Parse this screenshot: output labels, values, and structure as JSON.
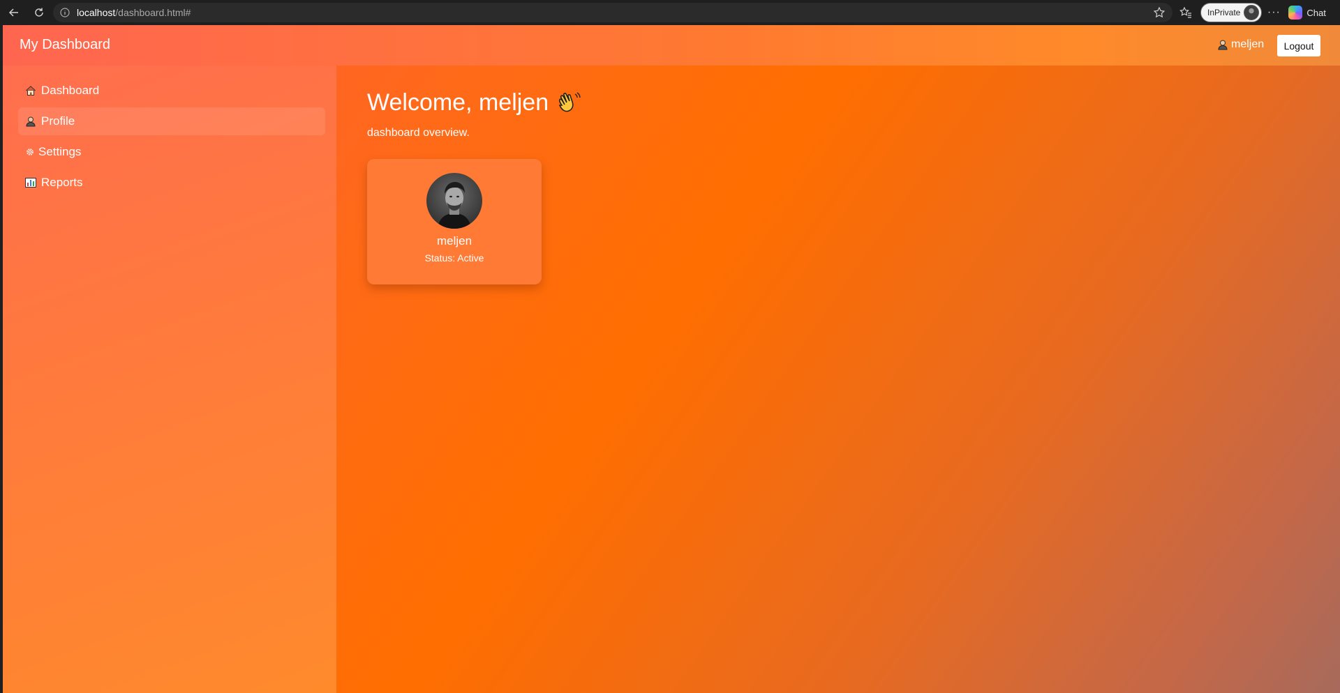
{
  "browser": {
    "url_host": "localhost",
    "url_path": "/dashboard.html#",
    "inprivate_label": "InPrivate",
    "chat_label": "Chat",
    "more_label": "···"
  },
  "header": {
    "brand": "My Dashboard",
    "username": "meljen",
    "logout_label": "Logout"
  },
  "sidebar": {
    "items": [
      {
        "label": "Dashboard",
        "icon": "house-icon"
      },
      {
        "label": "Profile",
        "icon": "user-icon",
        "active": true
      },
      {
        "label": "Settings",
        "icon": "gear-icon"
      },
      {
        "label": "Reports",
        "icon": "bar-chart-icon"
      }
    ]
  },
  "main": {
    "welcome": "Welcome, meljen",
    "subtitle": "dashboard overview.",
    "card": {
      "name": "meljen",
      "status": "Status: Active"
    }
  },
  "colors": {
    "accent": "#ff6e00",
    "topbar": "#ff7a30",
    "sidebar": "#ff7a3c",
    "card": "#ff7a34"
  }
}
